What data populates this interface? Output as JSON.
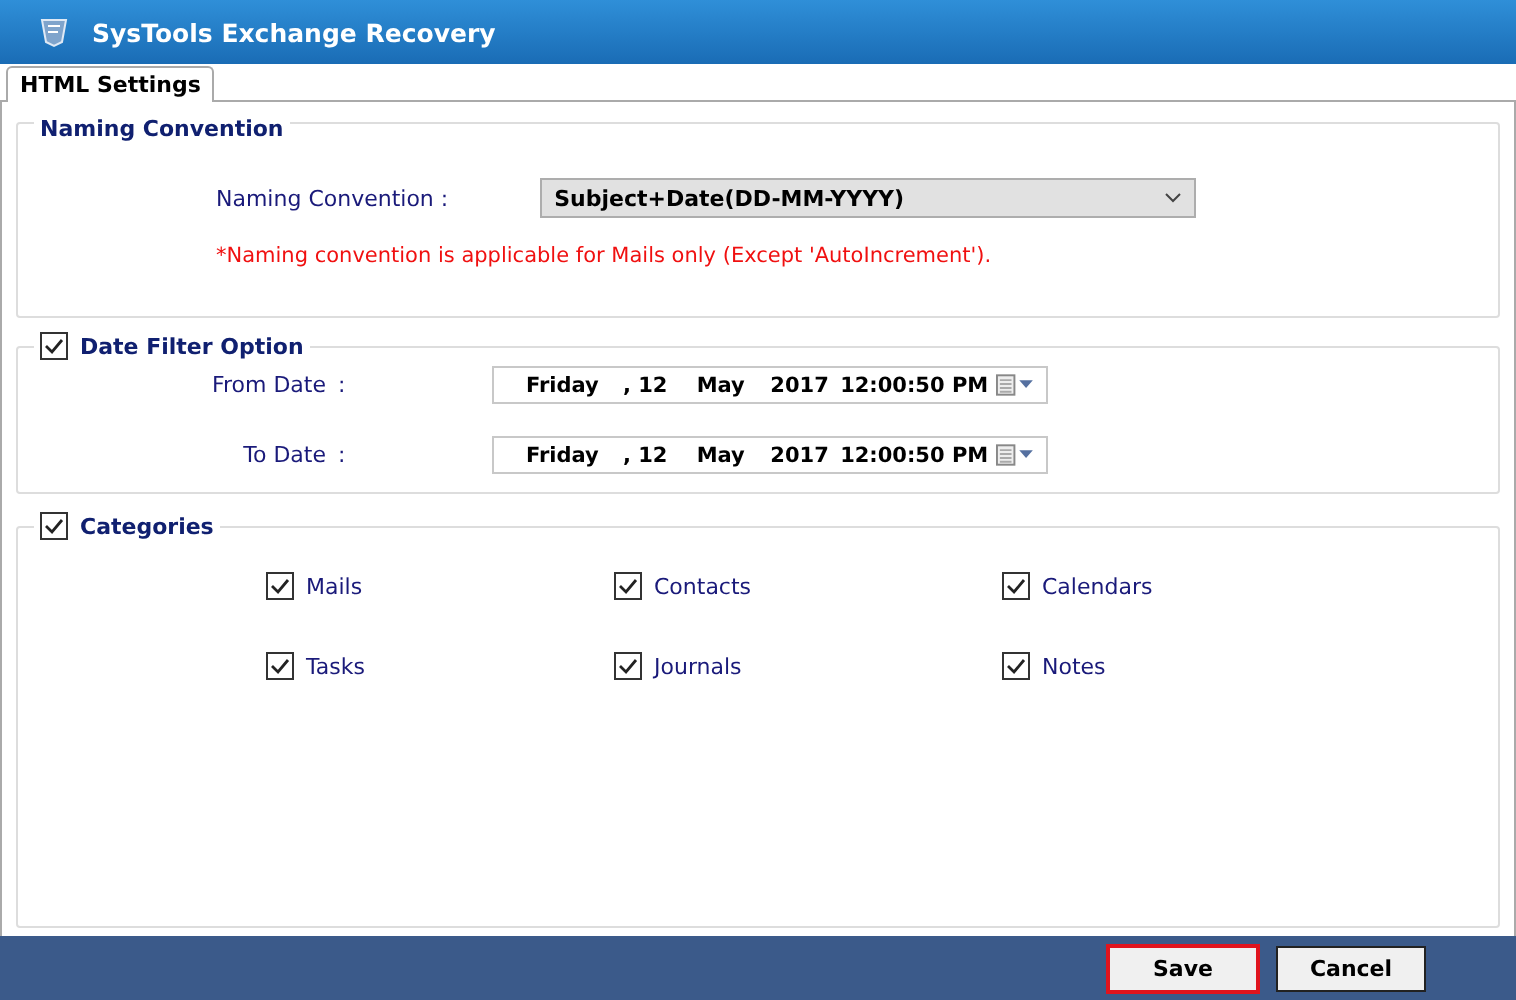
{
  "window": {
    "title": "SysTools  Exchange Recovery"
  },
  "tabs": [
    {
      "label": "HTML Settings",
      "selected": true
    }
  ],
  "naming_convention": {
    "legend": "Naming Convention",
    "label": "Naming Convention :",
    "value": "Subject+Date(DD-MM-YYYY)",
    "note": "*Naming convention is applicable for Mails only (Except 'AutoIncrement')."
  },
  "date_filter": {
    "legend": "Date Filter Option",
    "checked": true,
    "rows": [
      {
        "label": "From Date",
        "colon": ":",
        "parts": [
          "Friday",
          ", 12",
          "May",
          "2017",
          "12:00:50 PM"
        ]
      },
      {
        "label": "To Date",
        "colon": ":",
        "parts": [
          "Friday",
          ", 12",
          "May",
          "2017",
          "12:00:50 PM"
        ]
      }
    ]
  },
  "categories": {
    "legend": "Categories",
    "checked": true,
    "items": [
      {
        "label": "Mails",
        "checked": true
      },
      {
        "label": "Contacts",
        "checked": true
      },
      {
        "label": "Calendars",
        "checked": true
      },
      {
        "label": "Tasks",
        "checked": true
      },
      {
        "label": "Journals",
        "checked": true
      },
      {
        "label": "Notes",
        "checked": true
      }
    ]
  },
  "buttons": [
    {
      "label": "Save",
      "focused": true
    },
    {
      "label": "Cancel",
      "focused": false
    }
  ]
}
